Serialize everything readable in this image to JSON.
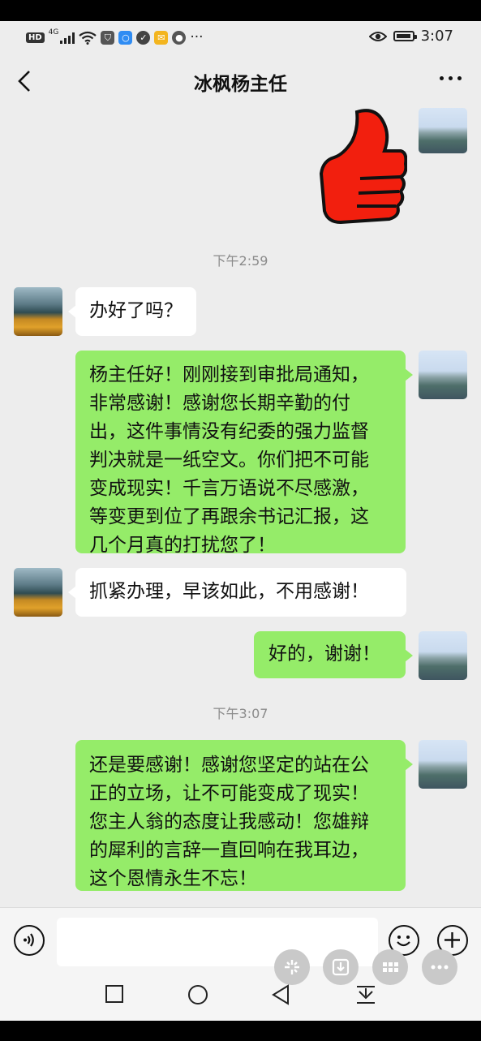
{
  "status_bar": {
    "left_icons": [
      "hd-icon",
      "4g-signal-icon",
      "wifi-icon",
      "app-icon",
      "search-app-icon",
      "shield-app-icon",
      "mail-app-icon",
      "app-icon"
    ],
    "hd_label": "HD",
    "net_label": "4G",
    "overflow": "···",
    "time": "3:07"
  },
  "header": {
    "title": "冰枫杨主任"
  },
  "messages": [
    {
      "type": "sticker",
      "side": "right",
      "sticker": "thumbs-up"
    },
    {
      "type": "time",
      "text": "下午2:59"
    },
    {
      "type": "text",
      "side": "left",
      "text": "办好了吗？"
    },
    {
      "type": "text",
      "side": "right",
      "lines": [
        "杨主任好！刚刚接到审批局通知，",
        "非常感谢！感谢您长期辛勤的付",
        "出，这件事情没有纪委的强力监督",
        "判决就是一纸空文。你们把不可能",
        "变成现实！千言万语说不尽感激，",
        "等变更到位了再跟余书记汇报，这",
        "几个月真的打扰您了！"
      ]
    },
    {
      "type": "text",
      "side": "left",
      "text": "抓紧办理，早该如此，不用感谢！"
    },
    {
      "type": "text",
      "side": "right",
      "text": "好的，谢谢！"
    },
    {
      "type": "time",
      "text": "下午3:07"
    },
    {
      "type": "text",
      "side": "right",
      "lines": [
        "还是要感谢！感谢您坚定的站在公",
        "正的立场，让不可能变成了现实！",
        "您主人翁的态度让我感动！您雄辩",
        "的犀利的言辞一直回响在我耳边，",
        "这个恩情永生不忘！"
      ]
    }
  ],
  "input_bar": {
    "voice_icon": "voice-icon",
    "emoji_icon": "emoji-icon",
    "plus_icon": "plus-icon",
    "message_value": ""
  },
  "floating_buttons": [
    "sparkle-icon",
    "download-icon",
    "grid-icon",
    "more-dots-icon"
  ],
  "nav_bar": [
    "recent-apps-icon",
    "home-icon",
    "back-icon",
    "notification-pull-icon"
  ]
}
